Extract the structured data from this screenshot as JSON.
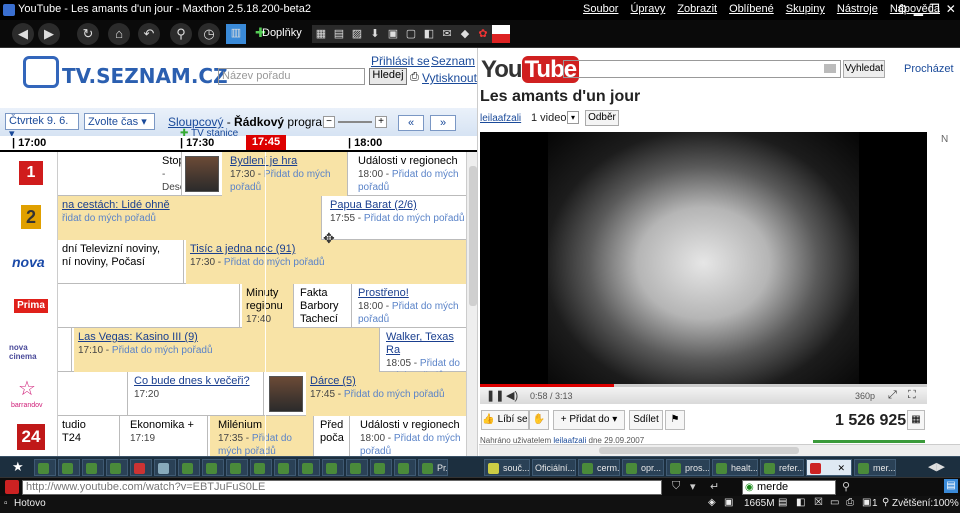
{
  "window": {
    "title": "YouTube - Les amants d'un jour - Maxthon 2.5.18.200-beta2",
    "menus": [
      "Soubor",
      "Úpravy",
      "Zobrazit",
      "Oblíbené",
      "Skupiny",
      "Nástroje",
      "Nápověda"
    ],
    "toolbar_addons_label": "Doplňky"
  },
  "tv": {
    "logo": "TV.SEZNAM.CZ",
    "login": "Přihlásit se",
    "seznam": "Seznam",
    "search_placeholder": "Název pořadu",
    "search_button": "Hledej",
    "print": "Vytisknout",
    "day_select": "Čtvrtek 9. 6.",
    "time_select": "Zvolte čas",
    "view_columns": "Sloupcový",
    "view_separator": " - ",
    "view_rows": "Řádkový",
    "view_program": " program",
    "stations": "TV stanice",
    "nav_prev": "«",
    "nav_next": "»",
    "times": [
      "| 17:00",
      "| 17:30",
      "| 18:00"
    ],
    "now": "17:45",
    "channels": [
      {
        "name": "ČT1",
        "logo": "1",
        "color": "#d01c1c"
      },
      {
        "name": "ČT2",
        "logo": "2",
        "color": "#e0a000"
      },
      {
        "name": "Nova",
        "logo": "nova",
        "color": "#1b4aa8"
      },
      {
        "name": "Prima",
        "logo": "Prima",
        "color": "#e0201a"
      },
      {
        "name": "Nova Cinema",
        "logo": "nova cinema",
        "color": "#4a4a9a"
      },
      {
        "name": "Barrandov",
        "logo": "barrandov",
        "color": "#d0207a"
      },
      {
        "name": "ČT24",
        "logo": "24",
        "color": "#c01818"
      }
    ],
    "add_label": "Přidat do mých pořadů",
    "programs": {
      "r1a_title": "Stop",
      "r1a_line2": "-",
      "r1a_line3": "Desc",
      "r1b_title": "Bydlení je hra",
      "r1b_time": "17:30",
      "r1c_title": "Události v regionech",
      "r1c_time": "18:00",
      "r2a_title": "na cestách: Lidé ohně",
      "r2a_add": "řidat do mých pořadů",
      "r2b_title": "Papua Barat (2/6)",
      "r2b_time": "17:55",
      "r3a_title": "dní Televizní noviny,",
      "r3a_line2": "ní noviny, Počasí",
      "r3b_title": "Tisíc a jedna noc (91)",
      "r3b_time": "17:30",
      "r4a_title": "Minuty",
      "r4a_line2": "regionu",
      "r4a_line3": "17:40",
      "r4b_title": "Fakta",
      "r4b_line2": "Barbory",
      "r4b_line3": "Tachecí",
      "r4c_title": "Prostřeno!",
      "r4c_time": "18:00",
      "r5a_title": "Las Vegas: Kasino III (9)",
      "r5a_time": "17:10",
      "r5b_title": "Walker, Texas Ra",
      "r5b_time": "18:05",
      "r6a_title": "Co bude dnes k večeři?",
      "r6a_time": "17:20",
      "r6b_title": "Dárce (5)",
      "r6b_time": "17:45",
      "r7a_title": "tudio",
      "r7a_line2": "T24",
      "r7b_title": "Ekonomika +",
      "r7b_time": "17:19",
      "r7c_title": "Milénium",
      "r7c_time": "17:35",
      "r7d_title": "Před",
      "r7d_line2": "poča",
      "r7e_title": "Události v regionech",
      "r7e_time": "18:00"
    }
  },
  "youtube": {
    "logo_you": "You",
    "logo_tube": "Tube",
    "search_button": "Vyhledat",
    "browse": "Procházet",
    "title": "Les amants d'un jour",
    "user": "leilaafzali",
    "video_count": "1 video",
    "subscribe": "Odběr",
    "time": "0:58 / 3:13",
    "quality": "360p",
    "like": "Líbí se",
    "add_to": "Přidat do",
    "share": "Sdílet",
    "views": "1 526 925",
    "uploaded_prefix": "Nahráno uživatelem",
    "uploaded_user": "leilaafzali",
    "uploaded_date": "dne 29.09.2007",
    "progress": 0.3,
    "side_letter": "N"
  },
  "tabs": [
    {
      "label": "Pr..."
    },
    {
      "label": "souč..."
    },
    {
      "label": "Oficiální..."
    },
    {
      "label": "cerm..."
    },
    {
      "label": "opr..."
    },
    {
      "label": "pros..."
    },
    {
      "label": "healt..."
    },
    {
      "label": "refer..."
    },
    {
      "label": "",
      "active": true
    },
    {
      "label": "mer..."
    }
  ],
  "address": {
    "url": "http://www.youtube.com/watch?v=EBTJuFuS0LE",
    "search": "merde"
  },
  "status": {
    "text": "Hotovo",
    "memory": "1665M",
    "tab_count": "1",
    "zoom": "Zvětšení:100%"
  }
}
